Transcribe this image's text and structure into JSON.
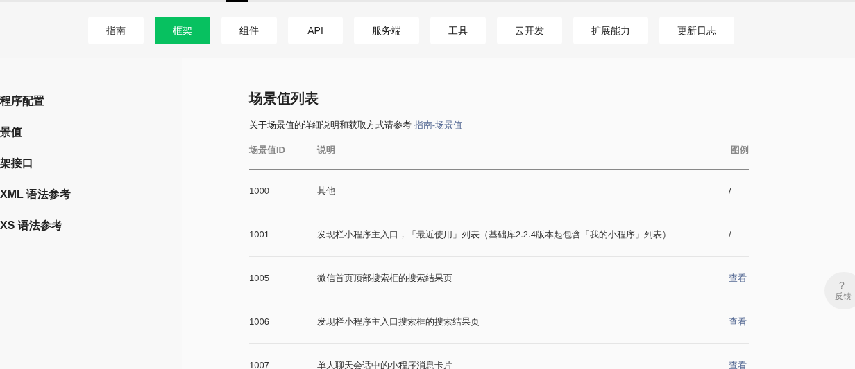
{
  "nav": {
    "tabs": [
      {
        "label": "指南",
        "selected": false
      },
      {
        "label": "框架",
        "selected": true
      },
      {
        "label": "组件",
        "selected": false
      },
      {
        "label": "API",
        "selected": false
      },
      {
        "label": "服务端",
        "selected": false
      },
      {
        "label": "工具",
        "selected": false
      },
      {
        "label": "云开发",
        "selected": false
      },
      {
        "label": "扩展能力",
        "selected": false
      },
      {
        "label": "更新日志",
        "selected": false
      }
    ]
  },
  "sidebar": {
    "items": [
      "程序配置",
      "景值",
      "架接口",
      "XML 语法参考",
      "XS 语法参考"
    ]
  },
  "content": {
    "title": "场景值列表",
    "description": "关于场景值的详细说明和获取方式请参考",
    "link": "指南-场景值",
    "table": {
      "columns": [
        "场景值ID",
        "说明",
        "图例"
      ],
      "rows": [
        {
          "id": "1000",
          "desc": "其他",
          "example": "/",
          "kind": "text"
        },
        {
          "id": "1001",
          "desc": "发现栏小程序主入口，「最近使用」列表（基础库2.2.4版本起包含「我的小程序」列表）",
          "example": "/",
          "kind": "text"
        },
        {
          "id": "1005",
          "desc": "微信首页顶部搜索框的搜索结果页",
          "example": "查看",
          "kind": "link"
        },
        {
          "id": "1006",
          "desc": "发现栏小程序主入口搜索框的搜索结果页",
          "example": "查看",
          "kind": "link"
        },
        {
          "id": "1007",
          "desc": "单人聊天会话中的小程序消息卡片",
          "example": "查看",
          "kind": "link"
        }
      ]
    }
  },
  "feedback": {
    "icon": "?",
    "label": "反馈"
  }
}
